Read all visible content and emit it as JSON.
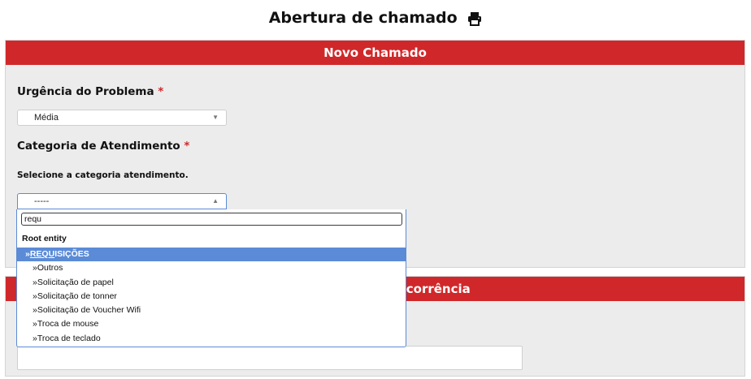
{
  "page": {
    "title": "Abertura de chamado",
    "print_icon": "printer-icon"
  },
  "panel_new_ticket": {
    "header": "Novo Chamado",
    "urgency": {
      "label": "Urgência do Problema",
      "required_mark": "*",
      "selected": "Média"
    },
    "category": {
      "label": "Categoria de Atendimento",
      "required_mark": "*",
      "hint": "Selecione a categoria atendimento.",
      "selected": "-----"
    }
  },
  "dropdown": {
    "search_value": "requ",
    "group": "Root entity",
    "items": [
      {
        "label": "»REQUISIÇÕES",
        "highlight": true,
        "match": "REQU",
        "rest": "ISIÇÕES",
        "prefix": "»"
      },
      {
        "label": "»Outros"
      },
      {
        "label": "»Solicitação de papel"
      },
      {
        "label": "»Solicitação de tonner"
      },
      {
        "label": "»Solicitação de Voucher Wifi"
      },
      {
        "label": "»Troca de mouse"
      },
      {
        "label": "»Troca de teclado"
      }
    ]
  },
  "panel_occurrence": {
    "header_visible_text": "Ocorrência"
  },
  "colors": {
    "header_red": "#d0282a",
    "highlight_blue": "#5b8bd6",
    "panel_bg": "#ececec"
  }
}
